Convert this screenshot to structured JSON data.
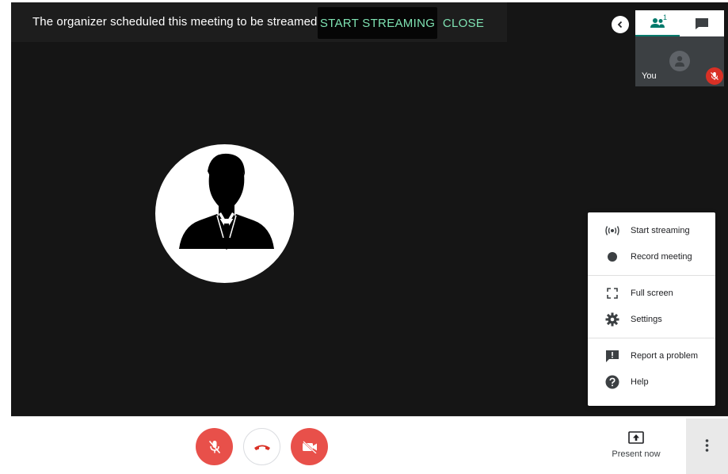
{
  "banner": {
    "message": "The organizer scheduled this meeting to be streamed",
    "start_streaming_label": "START STREAMING",
    "close_label": "CLOSE"
  },
  "side_panel": {
    "people_count": "1",
    "self_label": "You"
  },
  "menu": {
    "items": [
      {
        "label": "Start streaming",
        "icon": "broadcast-icon"
      },
      {
        "label": "Record meeting",
        "icon": "record-icon"
      },
      {
        "label": "Full screen",
        "icon": "fullscreen-icon"
      },
      {
        "label": "Settings",
        "icon": "gear-icon"
      },
      {
        "label": "Report a problem",
        "icon": "feedback-icon"
      },
      {
        "label": "Help",
        "icon": "help-icon"
      }
    ]
  },
  "controls": {
    "present_label": "Present now"
  },
  "colors": {
    "accent": "#7fe3b3",
    "danger": "#e8504a",
    "teal": "#00796b",
    "stage": "#151515"
  }
}
